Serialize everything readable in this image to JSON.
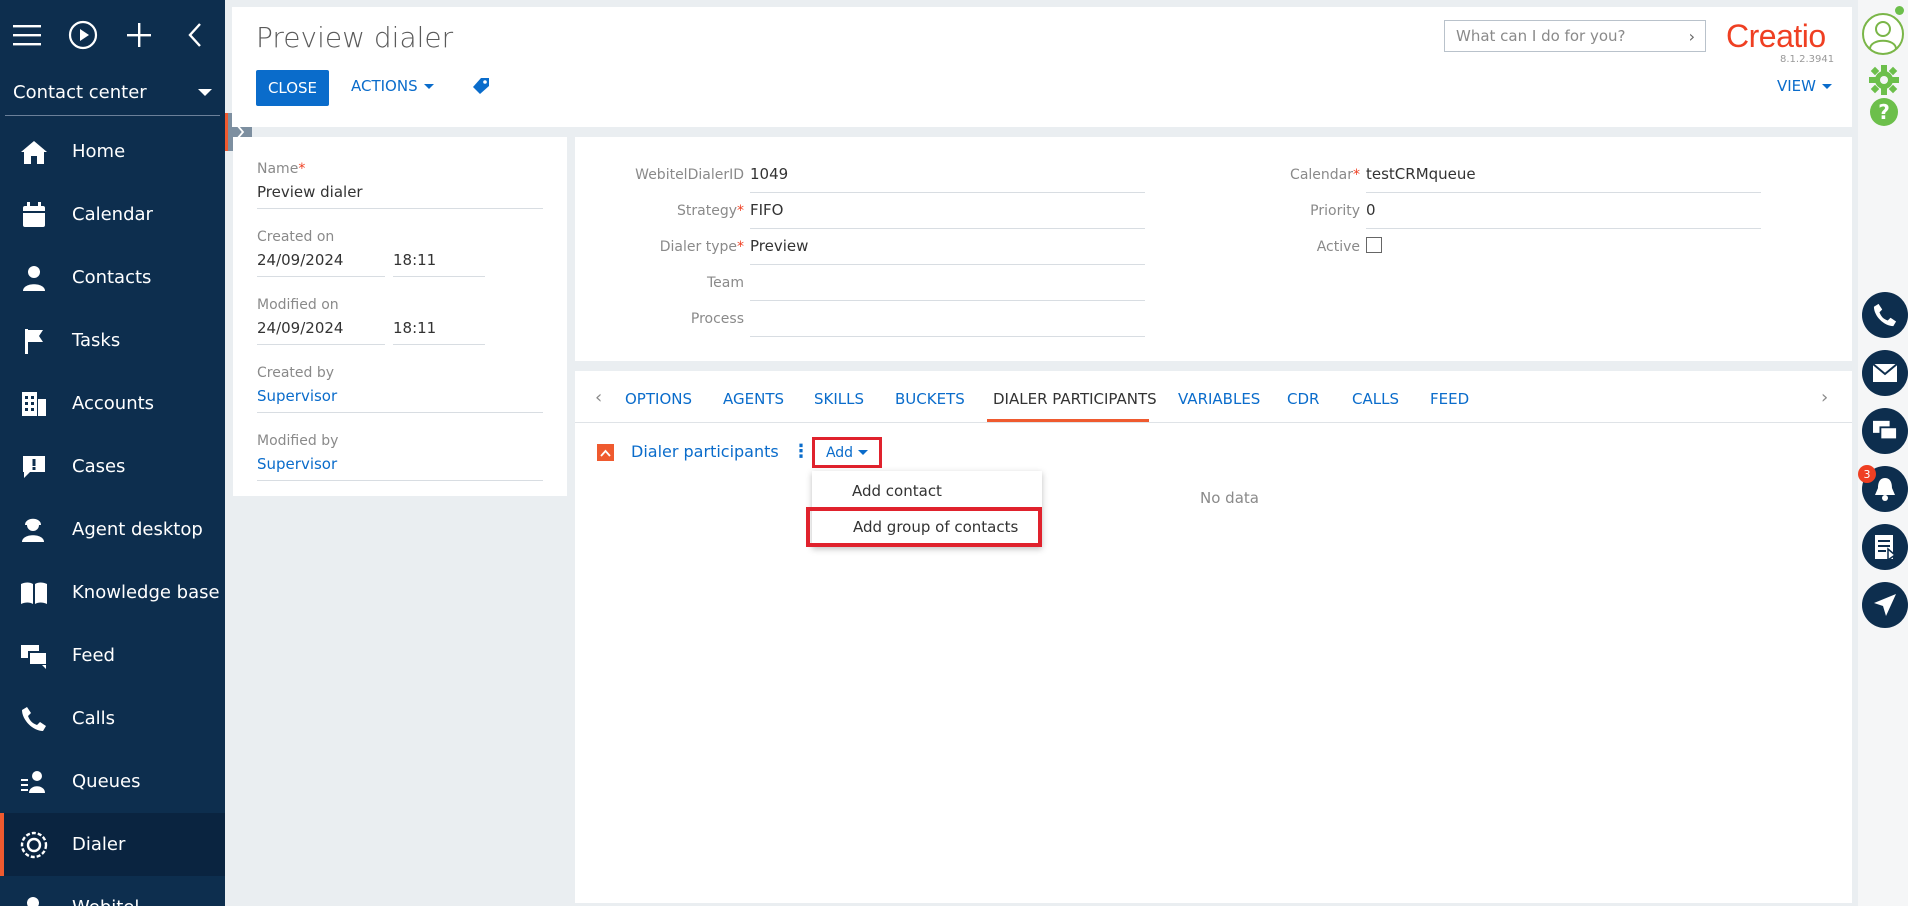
{
  "sidebar": {
    "workspace": "Contact center",
    "items": [
      {
        "label": "Home",
        "icon": "home-icon"
      },
      {
        "label": "Calendar",
        "icon": "calendar-icon"
      },
      {
        "label": "Contacts",
        "icon": "person-icon"
      },
      {
        "label": "Tasks",
        "icon": "flag-icon"
      },
      {
        "label": "Accounts",
        "icon": "building-icon"
      },
      {
        "label": "Cases",
        "icon": "case-icon"
      },
      {
        "label": "Agent desktop",
        "icon": "agent-icon"
      },
      {
        "label": "Knowledge base",
        "icon": "book-icon"
      },
      {
        "label": "Feed",
        "icon": "feed-icon"
      },
      {
        "label": "Calls",
        "icon": "phone-icon"
      },
      {
        "label": "Queues",
        "icon": "queue-icon"
      },
      {
        "label": "Dialer",
        "icon": "dialer-icon"
      },
      {
        "label": "Webitel",
        "icon": "webitel-icon"
      }
    ],
    "active": "Dialer"
  },
  "header": {
    "title": "Preview dialer",
    "close_label": "CLOSE",
    "actions_label": "ACTIONS",
    "search_placeholder": "What can I do for you?",
    "logo": "Creatio",
    "version": "8.1.2.3941",
    "view_label": "VIEW"
  },
  "info": {
    "name_label": "Name",
    "name_value": "Preview dialer",
    "created_on_label": "Created on",
    "created_on_date": "24/09/2024",
    "created_on_time": "18:11",
    "modified_on_label": "Modified on",
    "modified_on_date": "24/09/2024",
    "modified_on_time": "18:11",
    "created_by_label": "Created by",
    "created_by_value": "Supervisor",
    "modified_by_label": "Modified by",
    "modified_by_value": "Supervisor"
  },
  "fields": {
    "webitel_label": "WebitelDialerID",
    "webitel_value": "1049",
    "strategy_label": "Strategy",
    "strategy_value": "FIFO",
    "dialer_type_label": "Dialer type",
    "dialer_type_value": "Preview",
    "team_label": "Team",
    "team_value": "",
    "process_label": "Process",
    "process_value": "",
    "calendar_label": "Calendar",
    "calendar_value": "testCRMqueue",
    "priority_label": "Priority",
    "priority_value": "0",
    "active_label": "Active",
    "active_checked": false
  },
  "tabs": [
    "OPTIONS",
    "AGENTS",
    "SKILLS",
    "BUCKETS",
    "DIALER PARTICIPANTS",
    "VARIABLES",
    "CDR",
    "CALLS",
    "FEED"
  ],
  "active_tab": "DIALER PARTICIPANTS",
  "detail": {
    "title": "Dialer participants",
    "add_label": "Add",
    "no_data": "No data",
    "menu": [
      "Add contact",
      "Add group of contacts"
    ]
  },
  "rail": {
    "notification_count": "3"
  },
  "colors": {
    "sidebar_bg": "#0d2e4e",
    "accent": "#ef5a2f",
    "link": "#0a6ccb",
    "highlight": "#e0222d"
  }
}
